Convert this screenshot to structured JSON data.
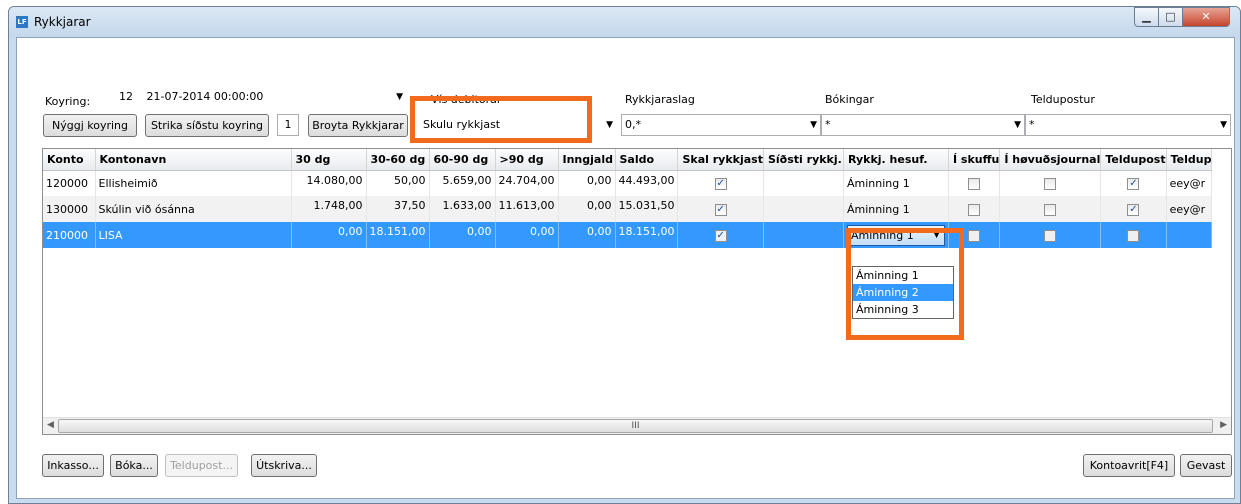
{
  "window": {
    "title": "Rykkjarar",
    "icon_text": "LF"
  },
  "top": {
    "koyring_label": "Koyring:",
    "koyring_number": "12",
    "koyring_datetime": "21-07-2014 00:00:00",
    "new_run_button": "Nýggj koyring",
    "delete_last_run_button": "Strika síðstu koyring",
    "run_count": "1",
    "change_reminders_button": "Broyta Rykkjarar",
    "vis_debitorar_label": "Vís debitorar",
    "vis_debitorar_value": "Skulu rykkjast",
    "rykkjaraslag_label": "Rykkjaraslag",
    "rykkjaraslag_value": "0,*",
    "bokingar_label": "Bókingar",
    "bokingar_value": "*",
    "teldupostur_label": "Teldupostur",
    "teldupostur_value": "*"
  },
  "grid": {
    "columns": [
      "Konto",
      "Kontonavn",
      "30 dg",
      "30-60 dg",
      "60-90 dg",
      ">90 dg",
      "Inngjald",
      "Saldo",
      "Skal rykkjast",
      "Síðsti rykkj.",
      "Rykkj. hesuf.",
      "Í skuffu",
      "Í høvuðsjournal",
      "Teldupost",
      "Teldup"
    ],
    "rows": [
      {
        "konto": "120000",
        "navn": "Ellisheimið",
        "d30": "14.080,00",
        "d30_60": "50,00",
        "d60_90": "5.659,00",
        "d90": "24.704,00",
        "inngjald": "0,00",
        "saldo": "44.493,00",
        "skal": true,
        "sidsti": "",
        "hesuf": "Áminning 1",
        "skuffu": false,
        "journal": false,
        "teldupost": true,
        "email": "eey@r"
      },
      {
        "konto": "130000",
        "navn": "Skúlin við ósánna",
        "d30": "1.748,00",
        "d30_60": "37,50",
        "d60_90": "1.633,00",
        "d90": "11.613,00",
        "inngjald": "0,00",
        "saldo": "15.031,50",
        "skal": true,
        "sidsti": "",
        "hesuf": "Áminning 1",
        "skuffu": false,
        "journal": false,
        "teldupost": true,
        "email": "eey@r"
      },
      {
        "konto": "210000",
        "navn": "LISA",
        "d30": "0,00",
        "d30_60": "18.151,00",
        "d60_90": "0,00",
        "d90": "0,00",
        "inngjald": "0,00",
        "saldo": "18.151,00",
        "skal": true,
        "sidsti": "",
        "hesuf": "Áminning 1",
        "skuffu": false,
        "journal": false,
        "teldupost": false,
        "email": ""
      }
    ],
    "dropdown_options": [
      "Áminning 1",
      "Áminning 2",
      "Áminning 3"
    ],
    "dropdown_highlighted": "Áminning 2"
  },
  "bottom": {
    "inkasso_button": "Inkasso...",
    "boka_button": "Bóka...",
    "teldupost_button": "Teldupost...",
    "utskriva_button": "Útskriva...",
    "kontoavrit_button": "Kontoavrit[F4]",
    "gevast_button": "Gevast"
  },
  "colors": {
    "selection": "#3399ff",
    "highlight_box": "#f26b1d"
  },
  "icons": {
    "checked": "✓",
    "dropdown_arrow": "▼",
    "scroll_left": "◀",
    "scroll_right": "▶",
    "scroll_grip": "III"
  }
}
